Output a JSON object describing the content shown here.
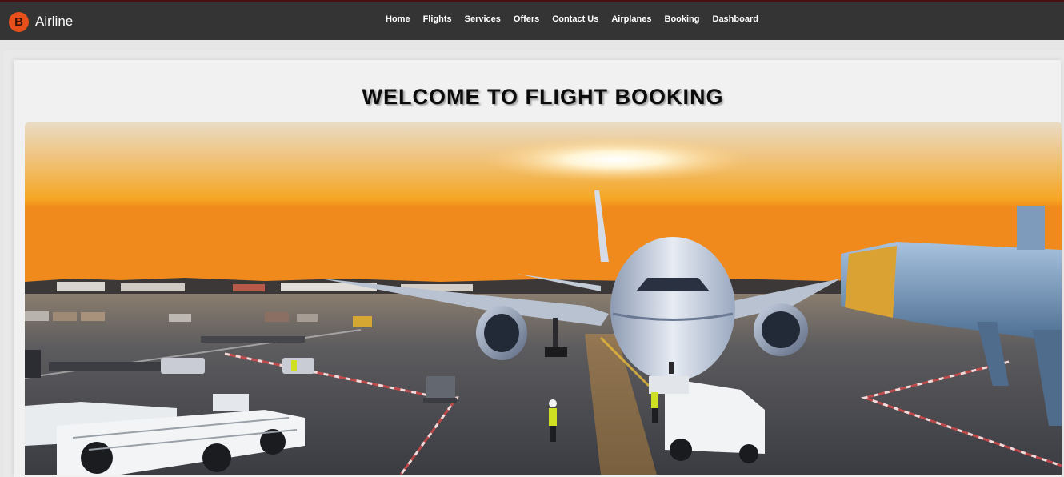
{
  "brand": {
    "logo_letter": "B",
    "name": "Airline"
  },
  "nav": {
    "items": [
      "Home",
      "Flights",
      "Services",
      "Offers",
      "Contact Us",
      "Airplanes",
      "Booking",
      "Dashboard"
    ]
  },
  "hero": {
    "title": "WELCOME TO FLIGHT BOOKING",
    "image_subject": "airplane-at-airport-sunset"
  },
  "colors": {
    "navbar": "#343434",
    "logo": "#e8501b",
    "page_bg": "#e6e6e6",
    "card_bg": "#f1f1f1"
  }
}
